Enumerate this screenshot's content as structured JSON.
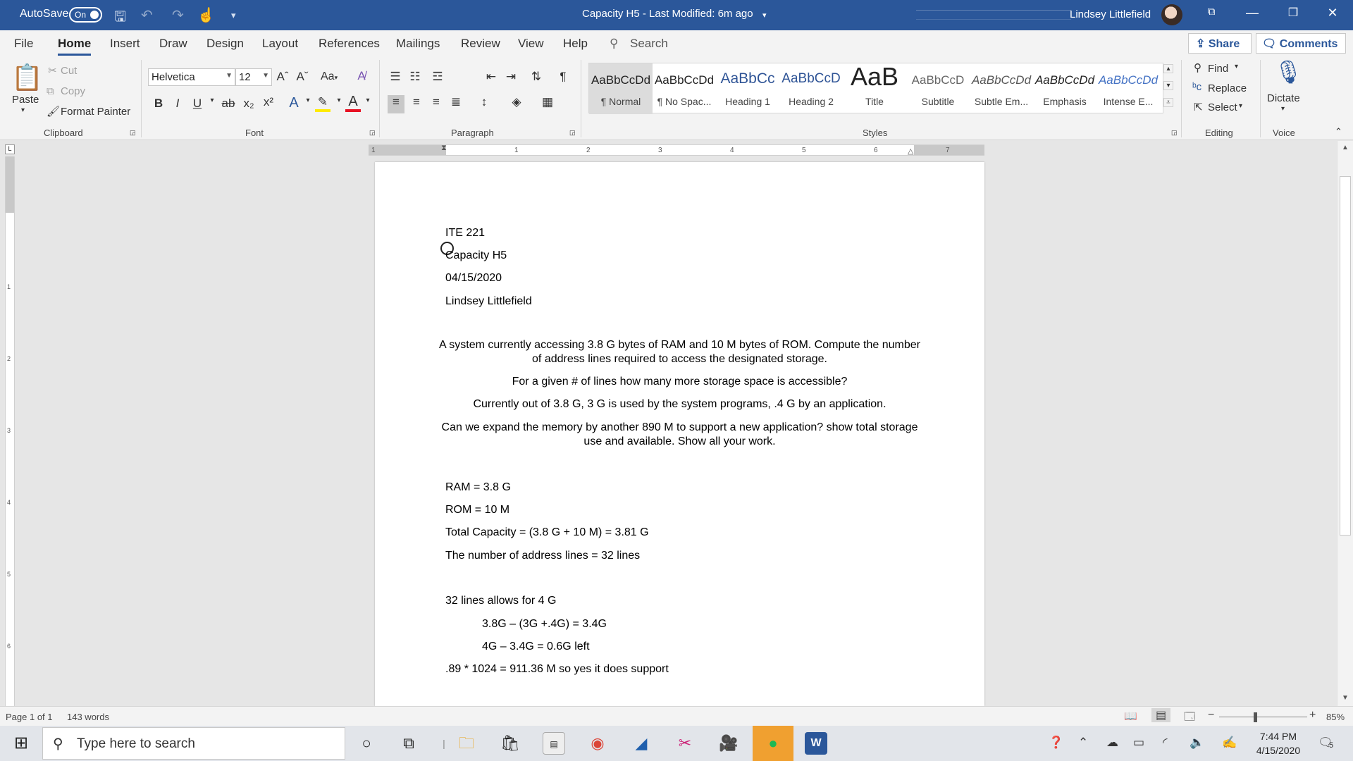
{
  "titlebar": {
    "autosave_label": "AutoSave",
    "autosave_state": "On",
    "document_title": "Capacity H5  -  Last Modified: 6m ago",
    "user_name": "Lindsey Littlefield"
  },
  "menu": {
    "tabs": [
      "File",
      "Home",
      "Insert",
      "Draw",
      "Design",
      "Layout",
      "References",
      "Mailings",
      "Review",
      "View",
      "Help"
    ],
    "active_tab": "Home",
    "search_label": "Search",
    "share_label": "Share",
    "comments_label": "Comments"
  },
  "ribbon": {
    "clipboard": {
      "paste": "Paste",
      "cut": "Cut",
      "copy": "Copy",
      "format_painter": "Format Painter",
      "group_label": "Clipboard"
    },
    "font": {
      "font_name": "Helvetica",
      "font_size": "12",
      "case_label": "Aa",
      "group_label": "Font"
    },
    "paragraph": {
      "group_label": "Paragraph"
    },
    "styles": {
      "items": [
        {
          "preview": "AaBbCcDd",
          "name": "¶ Normal"
        },
        {
          "preview": "AaBbCcDd",
          "name": "¶ No Spac..."
        },
        {
          "preview": "AaBbCc",
          "name": "Heading 1"
        },
        {
          "preview": "AaBbCcD",
          "name": "Heading 2"
        },
        {
          "preview": "AaB",
          "name": "Title"
        },
        {
          "preview": "AaBbCcD",
          "name": "Subtitle"
        },
        {
          "preview": "AaBbCcDd",
          "name": "Subtle Em..."
        },
        {
          "preview": "AaBbCcDd",
          "name": "Emphasis"
        },
        {
          "preview": "AaBbCcDd",
          "name": "Intense E..."
        }
      ],
      "group_label": "Styles"
    },
    "editing": {
      "find": "Find",
      "replace": "Replace",
      "select": "Select",
      "group_label": "Editing"
    },
    "voice": {
      "dictate": "Dictate",
      "group_label": "Voice"
    }
  },
  "ruler": {
    "h_ticks": [
      "1",
      "1",
      "2",
      "3",
      "4",
      "5",
      "6",
      "7"
    ],
    "v_ticks": [
      "1",
      "2",
      "3",
      "4",
      "5",
      "6"
    ],
    "corner": "L"
  },
  "document": {
    "header_lines": [
      "ITE 221",
      "Capacity H5",
      "04/15/2020",
      "Lindsey Littlefield"
    ],
    "question_lines": [
      "A system currently accessing 3.8 G bytes of RAM and 10 M bytes of ROM. Compute the number of address lines required to access the designated storage.",
      "For a given # of lines how many more storage space is accessible?",
      "Currently out of 3.8 G,  3 G is used by the system programs, .4 G by an application.",
      "Can we expand the memory by another 890 M to support a new application?  show total storage use and available. Show all your work."
    ],
    "answer_lines": [
      "RAM = 3.8 G",
      "ROM = 10 M",
      "Total Capacity = (3.8 G + 10 M) = 3.81 G",
      "The number of address lines = 32 lines",
      "32 lines allows for 4 G",
      "3.8G – (3G +.4G)  = 3.4G",
      "4G – 3.4G = 0.6G left",
      ".89 * 1024 = 911.36 M so yes it does support"
    ]
  },
  "status": {
    "page": "Page 1 of 1",
    "words": "143 words",
    "zoom_minus": "−",
    "zoom_plus": "+",
    "zoom": "85%"
  },
  "taskbar": {
    "search_placeholder": "Type here to search",
    "time": "7:44 PM",
    "date": "4/15/2020",
    "notification_count": "5"
  }
}
